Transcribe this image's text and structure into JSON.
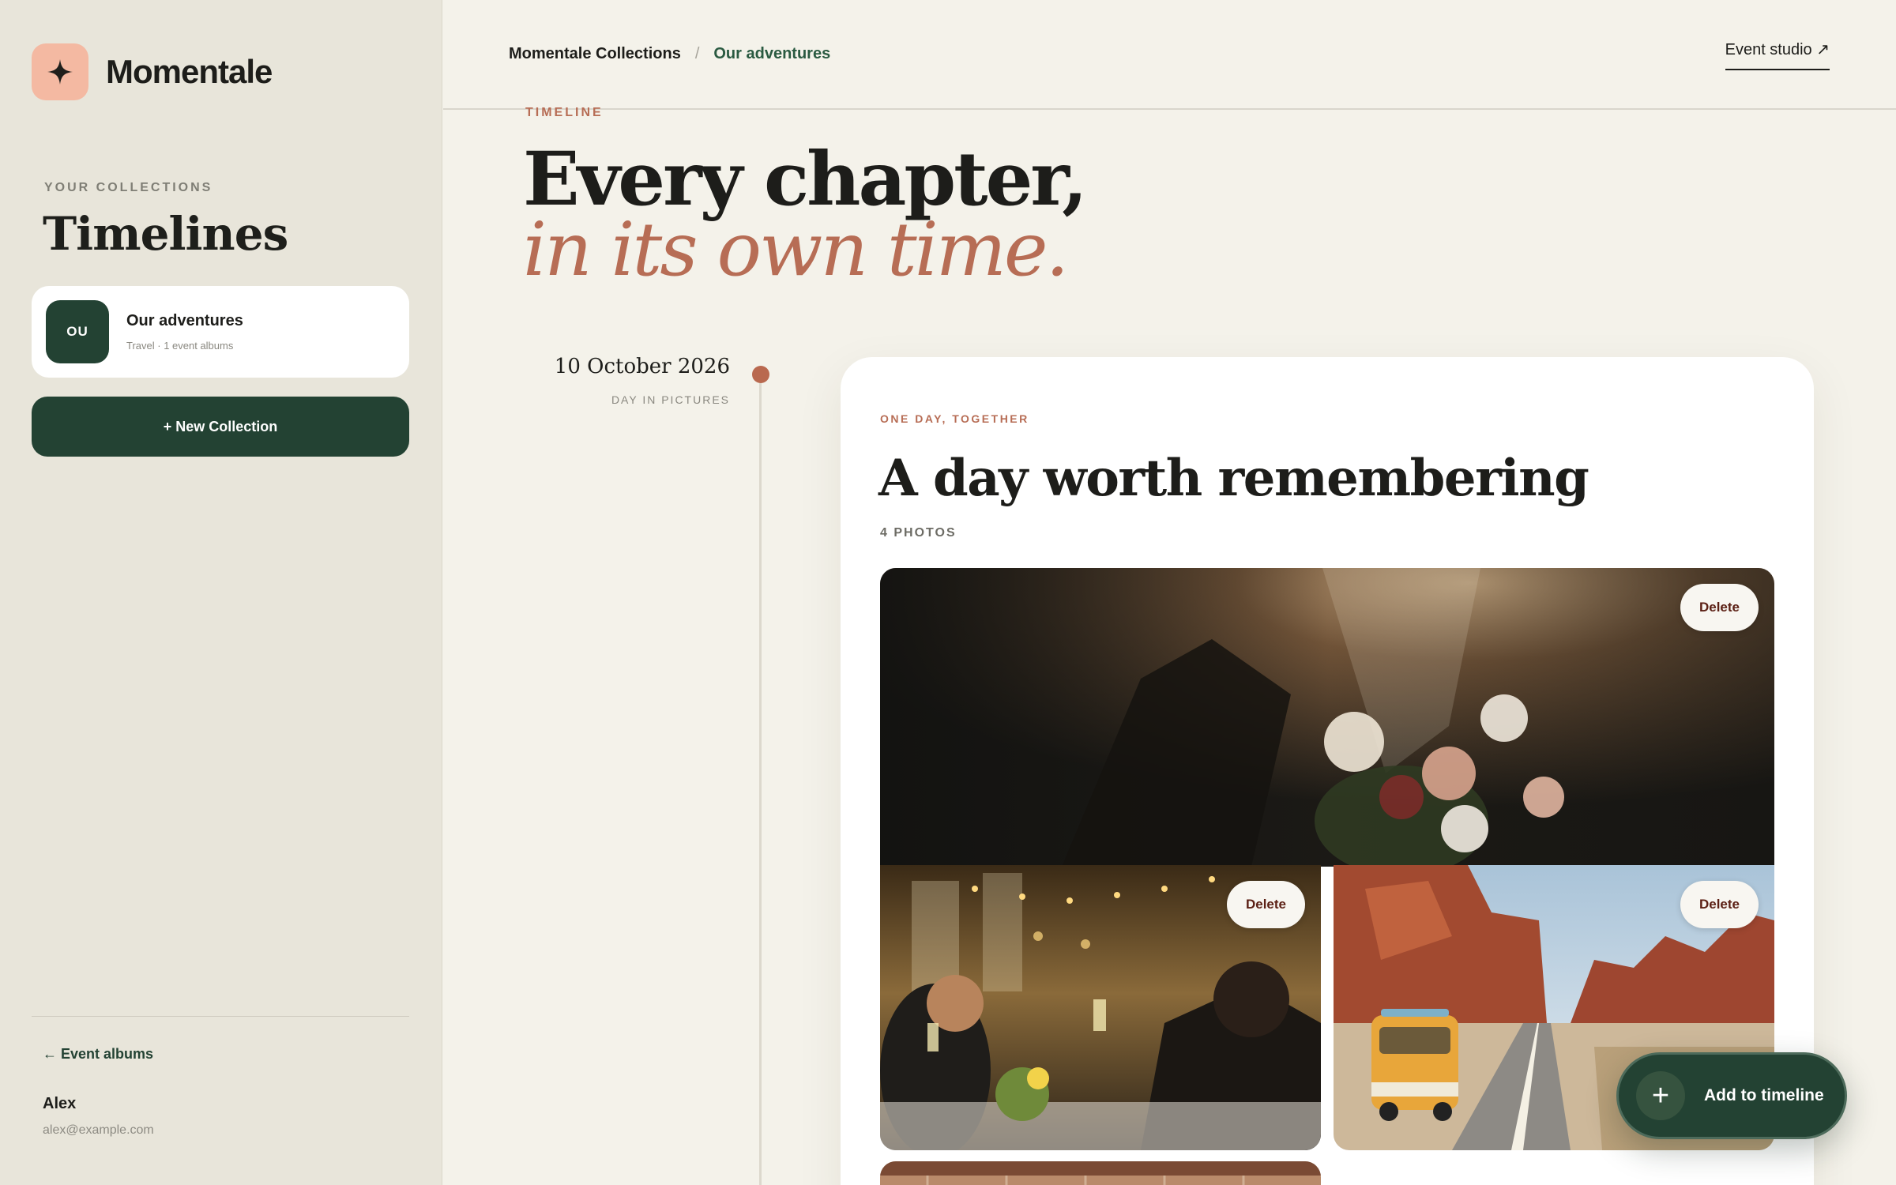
{
  "brand": {
    "name": "Momentale",
    "icon": "sparkle-icon"
  },
  "sidebar": {
    "eyebrow": "YOUR COLLECTIONS",
    "title": "Timelines",
    "collections": [
      {
        "initials": "OU",
        "name": "Our adventures",
        "meta": "Travel · 1 event albums"
      }
    ],
    "new_button": "+ New Collection",
    "back_link": "← Event albums",
    "user": {
      "name": "Alex",
      "email": "alex@example.com"
    }
  },
  "header": {
    "breadcrumb_root": "Momentale Collections",
    "breadcrumb_sep": "/",
    "breadcrumb_current": "Our adventures",
    "studio_link": "Event studio ↗"
  },
  "main": {
    "eyebrow": "TIMELINE",
    "hero_line1": "Every chapter,",
    "hero_line2": "in its own time.",
    "timeline_entry": {
      "date": "10 October 2026",
      "date_sub": "DAY IN PICTURES",
      "eyebrow": "ONE DAY, TOGETHER",
      "title": "A day worth remembering",
      "count": "4 PHOTOS",
      "delete_label": "Delete",
      "photos": [
        "wedding-bouquet-photo",
        "dinner-toast-photo",
        "desert-van-photo",
        "venue-photo"
      ]
    }
  },
  "fab": {
    "label": "Add to timeline",
    "icon": "plus-icon"
  },
  "colors": {
    "accent": "#b76d55",
    "primary": "#234233",
    "background": "#f4f2ea",
    "sidebar": "#e8e5da"
  }
}
